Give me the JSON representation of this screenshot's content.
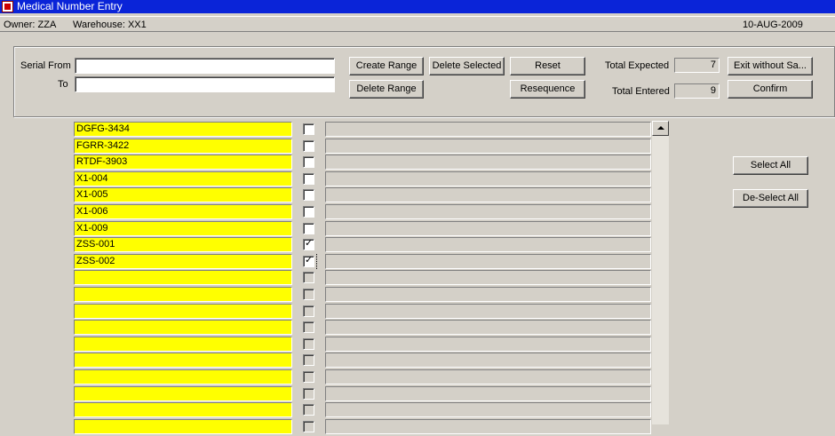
{
  "window": {
    "title": "Medical Number Entry"
  },
  "info": {
    "owner": "Owner:  ZZA",
    "warehouse": "Warehouse:  XX1",
    "date": "10-AUG-2009"
  },
  "form": {
    "serial_from_label": "Serial From",
    "to_label": "To",
    "serial_from_value": "",
    "to_value": ""
  },
  "buttons": {
    "create_range": "Create Range",
    "delete_range": "Delete Range",
    "delete_selected": "Delete Selected",
    "reset": "Reset",
    "resequence": "Resequence",
    "exit_without_save": "Exit without Sa...",
    "confirm": "Confirm",
    "select_all": "Select All",
    "deselect_all": "De-Select All"
  },
  "totals": {
    "expected_label": "Total Expected",
    "expected_value": "7",
    "entered_label": "Total Entered",
    "entered_value": "9"
  },
  "rows": [
    {
      "serial": "DGFG-3434",
      "checked": false
    },
    {
      "serial": "FGRR-3422",
      "checked": false
    },
    {
      "serial": "RTDF-3903",
      "checked": false
    },
    {
      "serial": "X1-004",
      "checked": false
    },
    {
      "serial": "X1-005",
      "checked": false
    },
    {
      "serial": "X1-006",
      "checked": false
    },
    {
      "serial": "X1-009",
      "checked": false
    },
    {
      "serial": "ZSS-001",
      "checked": true
    },
    {
      "serial": "ZSS-002",
      "checked": true
    },
    {
      "serial": "",
      "checked": false
    },
    {
      "serial": "",
      "checked": false
    },
    {
      "serial": "",
      "checked": false
    },
    {
      "serial": "",
      "checked": false
    },
    {
      "serial": "",
      "checked": false
    },
    {
      "serial": "",
      "checked": false
    },
    {
      "serial": "",
      "checked": false
    },
    {
      "serial": "",
      "checked": false
    },
    {
      "serial": "",
      "checked": false
    },
    {
      "serial": "",
      "checked": false
    }
  ]
}
